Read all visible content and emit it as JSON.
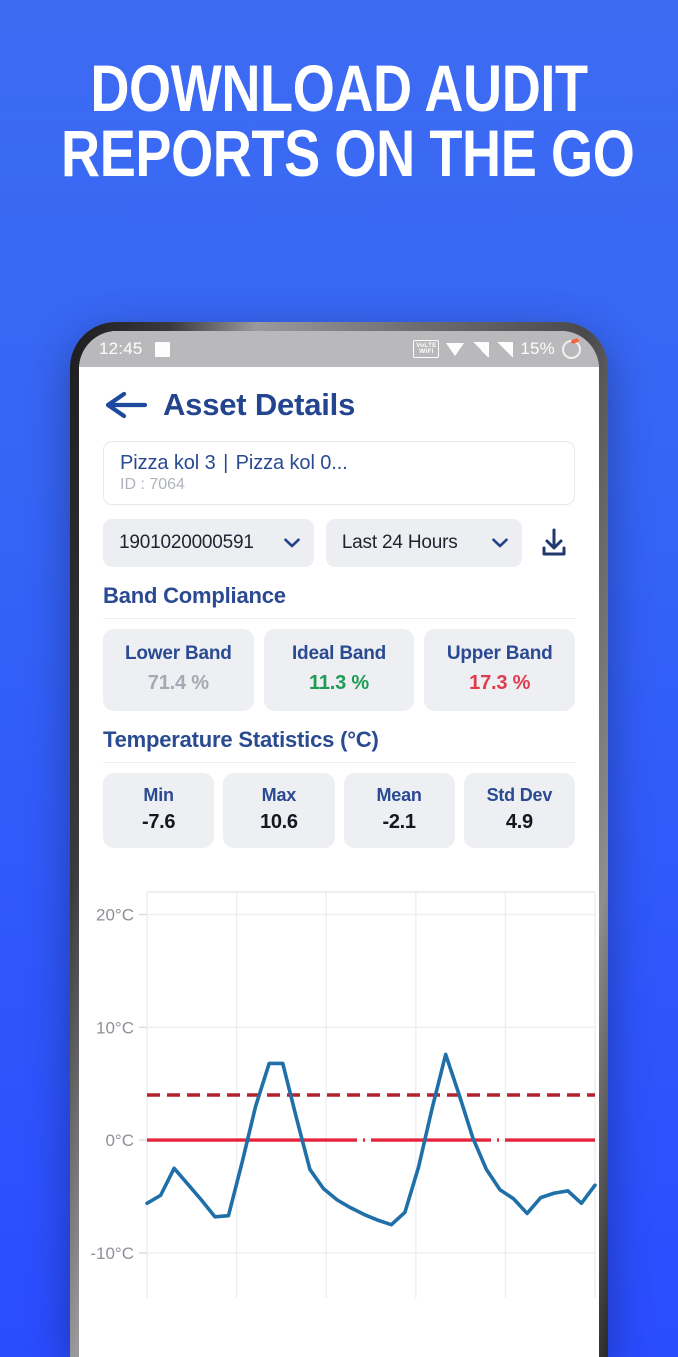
{
  "headline": {
    "line1": "DOWNLOAD AUDIT",
    "line2": "REPORTS ON THE GO"
  },
  "statusbar": {
    "time": "12:45",
    "recording_icon": "square-icon",
    "vowifi_top": "VoLTE",
    "vowifi_bottom": "WiFi",
    "wifi_icon": "wifi-icon",
    "signal_icon": "signal-bars-icon",
    "battery_percent": "15%",
    "battery_icon": "battery-ring-icon"
  },
  "appbar": {
    "back_icon": "back-arrow-icon",
    "title": "Asset Details"
  },
  "asset": {
    "name_primary": "Pizza kol 3",
    "separator": "|",
    "name_secondary": "Pizza kol 0...",
    "id_label": "ID : 7064"
  },
  "controls": {
    "serial_value": "1901020000591",
    "serial_chevron": "chevron-down-icon",
    "range_value": "Last 24 Hours",
    "range_chevron": "chevron-down-icon",
    "download_icon": "download-icon"
  },
  "band_compliance": {
    "title": "Band Compliance",
    "cards": [
      {
        "label": "Lower Band",
        "value": "71.4 %",
        "color": "#a6a9b4"
      },
      {
        "label": "Ideal Band",
        "value": "11.3 %",
        "color": "#1f9b54"
      },
      {
        "label": "Upper Band",
        "value": "17.3 %",
        "color": "#e03b4c"
      }
    ]
  },
  "temperature_statistics": {
    "title": "Temperature Statistics (°C)",
    "cards": [
      {
        "label": "Min",
        "value": "-7.6"
      },
      {
        "label": "Max",
        "value": "10.6"
      },
      {
        "label": "Mean",
        "value": "-2.1"
      },
      {
        "label": "Std Dev",
        "value": "4.9"
      }
    ]
  },
  "chart_data": {
    "type": "line",
    "title": "",
    "xlabel": "",
    "ylabel": "",
    "ylim": [
      -14,
      22
    ],
    "yticks": [
      20,
      10,
      0,
      -10
    ],
    "ytick_labels": [
      "20°C",
      "10°C",
      "0°C",
      "-10°C"
    ],
    "xticks": [
      0,
      6,
      12,
      18,
      24,
      30
    ],
    "xtick_labels": [
      "",
      "",
      "",
      "",
      "",
      ""
    ],
    "grid": true,
    "legend": "none",
    "line_color": "#1f6fa8",
    "series": [
      {
        "name": "Temperature",
        "color": "#1f6fa8",
        "x": [
          0,
          1,
          2,
          3,
          4,
          5,
          6,
          7,
          8,
          9,
          10,
          11,
          12,
          13,
          14,
          15,
          16,
          17,
          18,
          19,
          20,
          21,
          22,
          23,
          24,
          25,
          26,
          27,
          28,
          29,
          30,
          31,
          32,
          33
        ],
        "values": [
          -5.6,
          -4.9,
          -2.5,
          -3.9,
          -5.3,
          -6.8,
          -6.7,
          -2.0,
          3.0,
          6.8,
          6.8,
          2.0,
          -2.6,
          -4.3,
          -5.3,
          -6.0,
          -6.6,
          -7.1,
          -7.5,
          -6.4,
          -2.4,
          2.8,
          7.6,
          4.0,
          0.2,
          -2.6,
          -4.4,
          -5.2,
          -6.5,
          -5.1,
          -4.7,
          -4.5,
          -5.6,
          -4.0
        ]
      }
    ],
    "threshold_lines": [
      {
        "name": "Upper Band",
        "value": 4.0,
        "color": "#b3232e",
        "style": "dashed"
      },
      {
        "name": "Lower Band",
        "value": 0.0,
        "color": "#e5243c",
        "style": "solid"
      }
    ]
  }
}
